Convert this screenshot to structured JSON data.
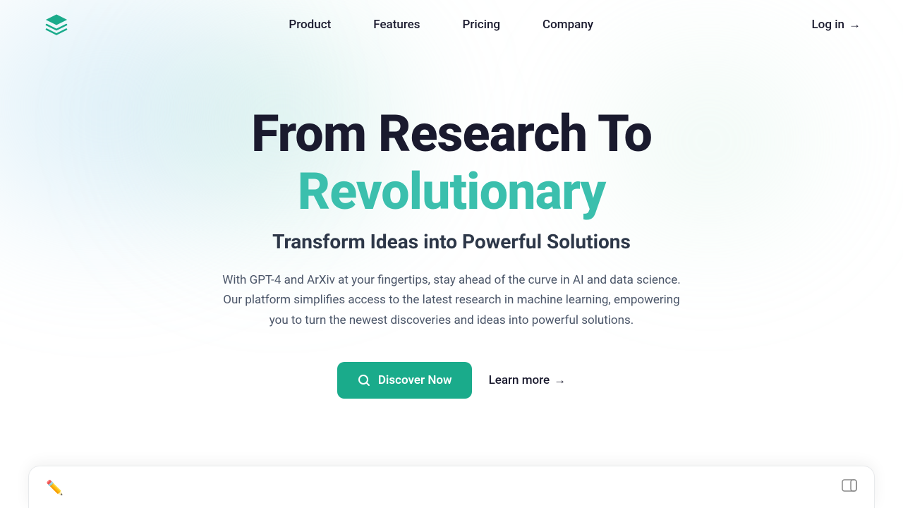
{
  "brand": {
    "logo_alt": "Stack logo"
  },
  "nav": {
    "links": [
      {
        "id": "product",
        "label": "Product"
      },
      {
        "id": "features",
        "label": "Features"
      },
      {
        "id": "pricing",
        "label": "Pricing"
      },
      {
        "id": "company",
        "label": "Company"
      }
    ],
    "login_label": "Log in",
    "login_arrow": "→"
  },
  "hero": {
    "title_line1": "From Research To",
    "title_line2": "Revolutionary",
    "subtitle": "Transform Ideas into Powerful Solutions",
    "description": "With GPT-4 and ArXiv at your fingertips, stay ahead of the curve in AI and data science. Our platform simplifies access to the latest research in machine learning, empowering you to turn the newest discoveries and ideas into powerful solutions.",
    "cta_primary": "Discover Now",
    "cta_secondary": "Learn more",
    "cta_secondary_arrow": "→"
  },
  "colors": {
    "accent": "#1aab8b",
    "title_gradient": "#3bbfad",
    "text_dark": "#1a1a2e",
    "text_mid": "#2d3748",
    "text_light": "#4a5568"
  }
}
